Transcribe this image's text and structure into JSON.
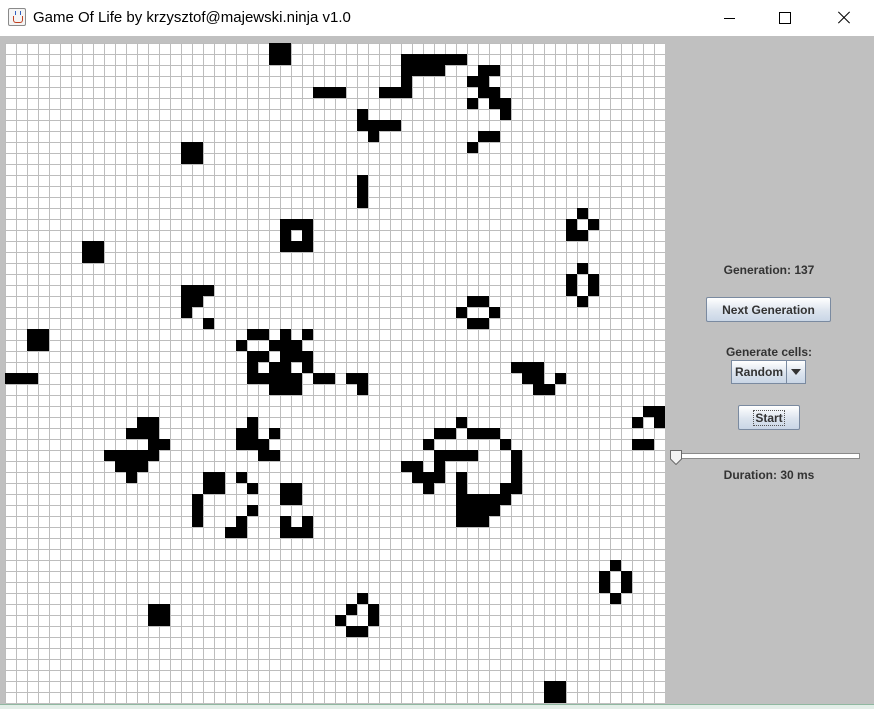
{
  "window": {
    "title": "Game Of Life by krzysztof@majewski.ninja v1.0",
    "icon": "java-cup-icon",
    "controls": [
      "minimize-icon",
      "maximize-icon",
      "close-icon"
    ]
  },
  "grid": {
    "columns": 60,
    "rows": 60,
    "live_cells": [
      [
        24,
        0
      ],
      [
        25,
        0
      ],
      [
        24,
        1
      ],
      [
        25,
        1
      ],
      [
        36,
        1
      ],
      [
        37,
        1
      ],
      [
        38,
        1
      ],
      [
        39,
        1
      ],
      [
        40,
        1
      ],
      [
        41,
        1
      ],
      [
        36,
        2
      ],
      [
        37,
        2
      ],
      [
        38,
        2
      ],
      [
        39,
        2
      ],
      [
        43,
        2
      ],
      [
        44,
        2
      ],
      [
        36,
        3
      ],
      [
        42,
        3
      ],
      [
        43,
        3
      ],
      [
        28,
        4
      ],
      [
        29,
        4
      ],
      [
        30,
        4
      ],
      [
        34,
        4
      ],
      [
        35,
        4
      ],
      [
        36,
        4
      ],
      [
        43,
        4
      ],
      [
        44,
        4
      ],
      [
        42,
        5
      ],
      [
        44,
        5
      ],
      [
        45,
        5
      ],
      [
        32,
        6
      ],
      [
        45,
        6
      ],
      [
        32,
        7
      ],
      [
        33,
        7
      ],
      [
        34,
        7
      ],
      [
        35,
        7
      ],
      [
        33,
        8
      ],
      [
        43,
        8
      ],
      [
        44,
        8
      ],
      [
        16,
        9
      ],
      [
        17,
        9
      ],
      [
        42,
        9
      ],
      [
        16,
        10
      ],
      [
        17,
        10
      ],
      [
        32,
        12
      ],
      [
        32,
        13
      ],
      [
        32,
        14
      ],
      [
        52,
        15
      ],
      [
        51,
        16
      ],
      [
        53,
        16
      ],
      [
        25,
        16
      ],
      [
        26,
        16
      ],
      [
        27,
        16
      ],
      [
        51,
        17
      ],
      [
        52,
        17
      ],
      [
        25,
        17
      ],
      [
        27,
        17
      ],
      [
        25,
        18
      ],
      [
        26,
        18
      ],
      [
        27,
        18
      ],
      [
        7,
        18
      ],
      [
        8,
        18
      ],
      [
        7,
        19
      ],
      [
        8,
        19
      ],
      [
        52,
        20
      ],
      [
        51,
        21
      ],
      [
        53,
        21
      ],
      [
        51,
        22
      ],
      [
        53,
        22
      ],
      [
        52,
        23
      ],
      [
        16,
        22
      ],
      [
        17,
        22
      ],
      [
        18,
        22
      ],
      [
        16,
        23
      ],
      [
        17,
        23
      ],
      [
        42,
        23
      ],
      [
        43,
        23
      ],
      [
        16,
        24
      ],
      [
        41,
        24
      ],
      [
        44,
        24
      ],
      [
        18,
        25
      ],
      [
        42,
        25
      ],
      [
        43,
        25
      ],
      [
        2,
        26
      ],
      [
        3,
        26
      ],
      [
        22,
        26
      ],
      [
        23,
        26
      ],
      [
        25,
        26
      ],
      [
        27,
        26
      ],
      [
        2,
        27
      ],
      [
        3,
        27
      ],
      [
        21,
        27
      ],
      [
        24,
        27
      ],
      [
        25,
        27
      ],
      [
        26,
        27
      ],
      [
        25,
        28
      ],
      [
        26,
        28
      ],
      [
        22,
        28
      ],
      [
        23,
        28
      ],
      [
        27,
        28
      ],
      [
        22,
        29
      ],
      [
        24,
        29
      ],
      [
        25,
        29
      ],
      [
        27,
        29
      ],
      [
        46,
        29
      ],
      [
        47,
        29
      ],
      [
        48,
        29
      ],
      [
        0,
        30
      ],
      [
        1,
        30
      ],
      [
        2,
        30
      ],
      [
        22,
        30
      ],
      [
        23,
        30
      ],
      [
        24,
        30
      ],
      [
        25,
        30
      ],
      [
        26,
        30
      ],
      [
        28,
        30
      ],
      [
        29,
        30
      ],
      [
        31,
        30
      ],
      [
        32,
        30
      ],
      [
        47,
        30
      ],
      [
        48,
        30
      ],
      [
        50,
        30
      ],
      [
        24,
        31
      ],
      [
        25,
        31
      ],
      [
        26,
        31
      ],
      [
        32,
        31
      ],
      [
        48,
        31
      ],
      [
        49,
        31
      ],
      [
        58,
        33
      ],
      [
        59,
        33
      ],
      [
        12,
        34
      ],
      [
        13,
        34
      ],
      [
        22,
        34
      ],
      [
        41,
        34
      ],
      [
        57,
        34
      ],
      [
        59,
        34
      ],
      [
        11,
        35
      ],
      [
        12,
        35
      ],
      [
        13,
        35
      ],
      [
        21,
        35
      ],
      [
        22,
        35
      ],
      [
        24,
        35
      ],
      [
        39,
        35
      ],
      [
        40,
        35
      ],
      [
        42,
        35
      ],
      [
        43,
        35
      ],
      [
        44,
        35
      ],
      [
        13,
        36
      ],
      [
        14,
        36
      ],
      [
        21,
        36
      ],
      [
        22,
        36
      ],
      [
        23,
        36
      ],
      [
        38,
        36
      ],
      [
        45,
        36
      ],
      [
        57,
        36
      ],
      [
        58,
        36
      ],
      [
        9,
        37
      ],
      [
        10,
        37
      ],
      [
        11,
        37
      ],
      [
        12,
        37
      ],
      [
        13,
        37
      ],
      [
        23,
        37
      ],
      [
        24,
        37
      ],
      [
        39,
        37
      ],
      [
        40,
        37
      ],
      [
        41,
        37
      ],
      [
        42,
        37
      ],
      [
        46,
        37
      ],
      [
        10,
        38
      ],
      [
        11,
        38
      ],
      [
        12,
        38
      ],
      [
        36,
        38
      ],
      [
        37,
        38
      ],
      [
        39,
        38
      ],
      [
        46,
        38
      ],
      [
        11,
        39
      ],
      [
        18,
        39
      ],
      [
        19,
        39
      ],
      [
        21,
        39
      ],
      [
        37,
        39
      ],
      [
        38,
        39
      ],
      [
        39,
        39
      ],
      [
        41,
        39
      ],
      [
        46,
        39
      ],
      [
        18,
        40
      ],
      [
        19,
        40
      ],
      [
        22,
        40
      ],
      [
        25,
        40
      ],
      [
        26,
        40
      ],
      [
        38,
        40
      ],
      [
        41,
        40
      ],
      [
        45,
        40
      ],
      [
        46,
        40
      ],
      [
        17,
        41
      ],
      [
        25,
        41
      ],
      [
        26,
        41
      ],
      [
        41,
        41
      ],
      [
        42,
        41
      ],
      [
        43,
        41
      ],
      [
        44,
        41
      ],
      [
        45,
        41
      ],
      [
        17,
        42
      ],
      [
        22,
        42
      ],
      [
        41,
        42
      ],
      [
        42,
        42
      ],
      [
        43,
        42
      ],
      [
        44,
        42
      ],
      [
        17,
        43
      ],
      [
        21,
        43
      ],
      [
        25,
        43
      ],
      [
        27,
        43
      ],
      [
        41,
        43
      ],
      [
        42,
        43
      ],
      [
        43,
        43
      ],
      [
        20,
        44
      ],
      [
        21,
        44
      ],
      [
        25,
        44
      ],
      [
        26,
        44
      ],
      [
        27,
        44
      ],
      [
        55,
        47
      ],
      [
        54,
        48
      ],
      [
        56,
        48
      ],
      [
        54,
        49
      ],
      [
        56,
        49
      ],
      [
        55,
        50
      ],
      [
        32,
        50
      ],
      [
        13,
        51
      ],
      [
        14,
        51
      ],
      [
        31,
        51
      ],
      [
        33,
        51
      ],
      [
        13,
        52
      ],
      [
        14,
        52
      ],
      [
        30,
        52
      ],
      [
        33,
        52
      ],
      [
        31,
        53
      ],
      [
        32,
        53
      ],
      [
        49,
        58
      ],
      [
        50,
        58
      ],
      [
        49,
        59
      ],
      [
        50,
        59
      ]
    ]
  },
  "panel": {
    "generation_label": "Generation: 137",
    "next_button": "Next Generation",
    "generate_cells_label": "Generate cells:",
    "generate_select": {
      "selected": "Random"
    },
    "start_button": "Start",
    "duration_slider": {
      "value_ms": 30
    },
    "duration_label": "Duration: 30 ms"
  }
}
